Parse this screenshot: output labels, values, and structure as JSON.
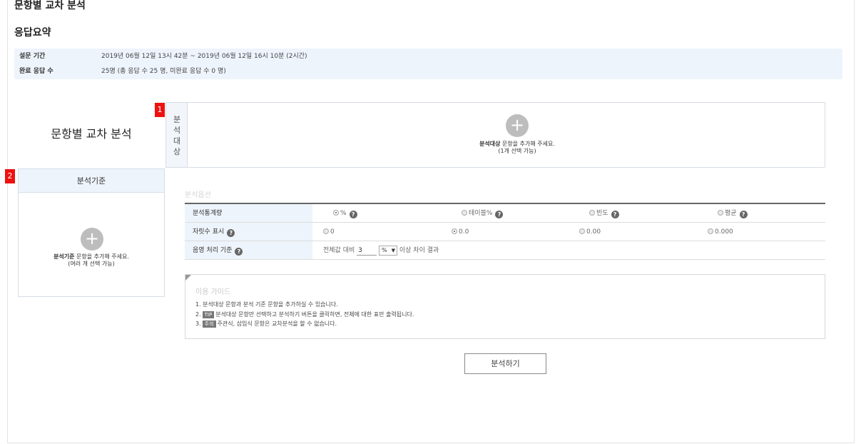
{
  "page": {
    "title": "문항별 교차 분석"
  },
  "summary": {
    "title": "응답요약",
    "period_label": "설문 기간",
    "period_value": "2019년 06월 12일 13시 42분 ~ 2019년 06월 12일 16시 10분 (2시간)",
    "responses_label": "완료 응답 수",
    "responses_value": "25명 (총 응답 수 25 명, 미완료 응답 수 0 명)"
  },
  "main_label": "문항별 교차 분석",
  "badges": {
    "target": "1",
    "criteria": "2"
  },
  "target": {
    "side_label": "분석대상",
    "plus": "+",
    "hint_bold": "분석대상",
    "hint_rest": " 문항을 추가해 주세요.",
    "hint_sub": "(1개 선택 가능)"
  },
  "criteria": {
    "head": "분석기준",
    "plus": "+",
    "hint_bold": "분석기준",
    "hint_rest": " 문항을 추가해 주세요.",
    "hint_sub": "(여러 개 선택 가능)"
  },
  "options": {
    "title": "분석옵션",
    "rows": [
      {
        "label": "분석통계량",
        "choices": [
          "%",
          "테이블%",
          "빈도",
          "평균"
        ],
        "selected": 0
      },
      {
        "label": "자릿수 표시",
        "choices": [
          "0",
          "0.0",
          "0.00",
          "0.000"
        ],
        "selected": 1
      },
      {
        "label": "음영 처리 기준",
        "prefix": "전체값 대비",
        "input_value": "3",
        "select_value": "%",
        "suffix": "이상 차이 결과"
      }
    ],
    "help": "?"
  },
  "guide": {
    "title": "이용 가이드",
    "line1": "1. 분석대상 문항과 분석 기준 문항을 추가하실 수 있습니다.",
    "line2_prefix": "2.",
    "line2_tag": "TIP",
    "line2_text": "분석대상 문항만 선택하고 분석하기 버튼을 클릭하면, 전체에 대한 표만 출력됩니다.",
    "line3_prefix": "3.",
    "line3_tag": "주의",
    "line3_text": "주관식, 삽입식 문항은 교차분석을 할 수 없습니다."
  },
  "analyze_button": "분석하기"
}
